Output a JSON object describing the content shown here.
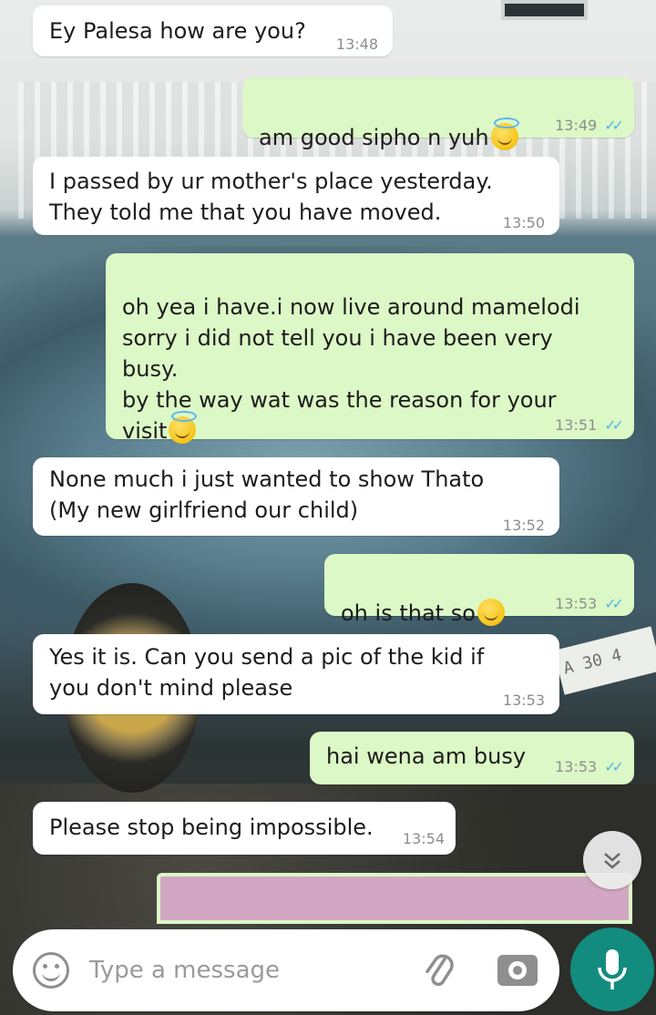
{
  "colors": {
    "incoming_bubble": "#ffffff",
    "outgoing_bubble": "#dcf8c6",
    "read_ticks": "#4fb6ec",
    "accent": "#128c7e"
  },
  "messages": [
    {
      "direction": "incoming",
      "text": "Ey Palesa how are you?",
      "time": "13:48"
    },
    {
      "direction": "outgoing",
      "text": "am good sipho n yuh",
      "emoji": "smiling-face-with-halo",
      "time": "13:49",
      "ticks": "✓✓"
    },
    {
      "direction": "incoming",
      "text": "I passed by ur mother's place yesterday.\nThey told me that you have moved.",
      "time": "13:50"
    },
    {
      "direction": "outgoing",
      "text": "oh yea i have.i now live around mamelodi\nsorry i did not tell you i have been very\nbusy.\nby the way wat was the reason for your\nvisit",
      "emoji": "smiling-face-with-halo",
      "time": "13:51",
      "ticks": "✓✓"
    },
    {
      "direction": "incoming",
      "text": "None much i just wanted to show Thato\n(My new girlfriend our child)",
      "time": "13:52"
    },
    {
      "direction": "outgoing",
      "text": "oh is that so",
      "emoji": "smirking-face",
      "time": "13:53",
      "ticks": "✓✓"
    },
    {
      "direction": "incoming",
      "text": "Yes it is. Can you send a pic of the kid if\nyou don't mind please",
      "time": "13:53"
    },
    {
      "direction": "outgoing",
      "text": "hai wena am busy",
      "time": "13:53",
      "ticks": "✓✓"
    },
    {
      "direction": "incoming",
      "text": "Please stop being impossible.",
      "time": "13:54"
    }
  ],
  "scroll_down_icon": "double-chevron-down-icon",
  "input": {
    "placeholder": "Type a message",
    "value": ""
  },
  "icons": {
    "emoji": "smiley-icon",
    "attach": "paperclip-icon",
    "camera": "camera-icon",
    "mic": "microphone-icon"
  },
  "wallpaper_plate": "A 30 4"
}
